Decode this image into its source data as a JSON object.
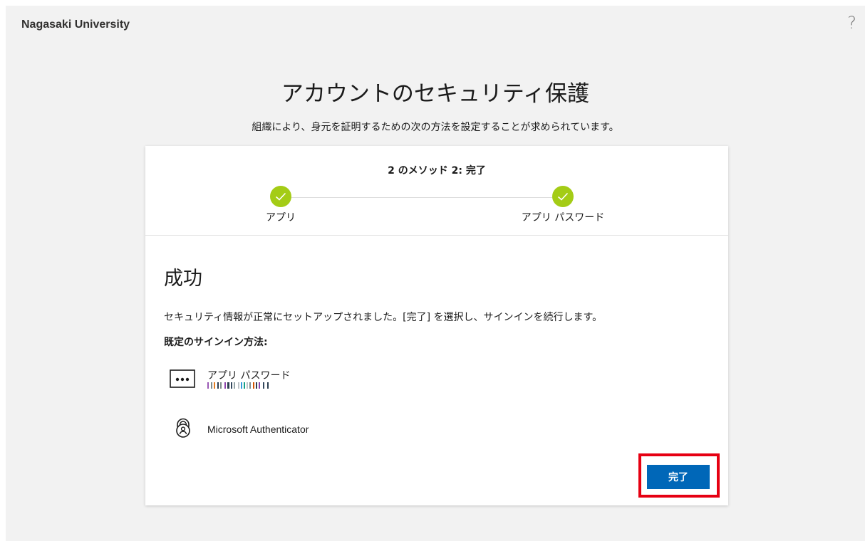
{
  "header": {
    "org_name": "Nagasaki University",
    "help": "?"
  },
  "page": {
    "title": "アカウントのセキュリティ保護",
    "subtitle": "組織により、身元を証明するための次の方法を設定することが求められています。"
  },
  "progress": {
    "title": "2 のメソッド 2: 完了",
    "steps": [
      {
        "label": "アプリ",
        "status": "complete"
      },
      {
        "label": "アプリ パスワード",
        "status": "complete"
      }
    ]
  },
  "success": {
    "title": "成功",
    "message": "セキュリティ情報が正常にセットアップされました。[完了] を選択し、サインインを続行します。",
    "default_label": "既定のサインイン方法:",
    "methods": [
      {
        "name": "アプリ パスワード",
        "icon": "password-dots-icon"
      },
      {
        "name": "Microsoft Authenticator",
        "icon": "authenticator-lock-icon"
      }
    ]
  },
  "actions": {
    "done_label": "完了"
  },
  "colors": {
    "accent": "#0067b8",
    "step_complete": "#a4cc16",
    "highlight": "#e60012"
  }
}
